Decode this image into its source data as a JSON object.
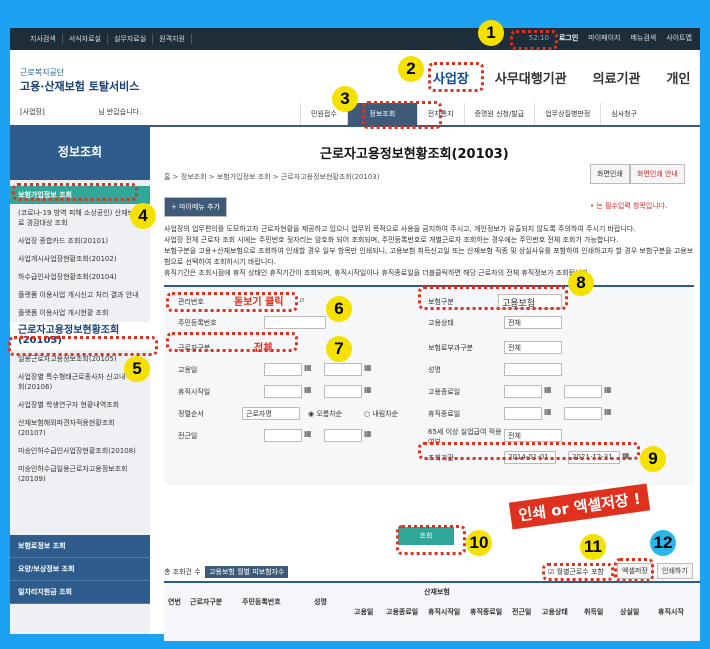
{
  "topbar": {
    "left": [
      "지사검색",
      "서식자료실",
      "실무자료실",
      "원격지원"
    ],
    "timer": "52:10",
    "login": "로그인",
    "right": [
      "마이페이지",
      "메뉴검색",
      "사이트맵"
    ]
  },
  "logo": {
    "sub": "근로복지공단",
    "main": "고용·산재보험 토탈서비스"
  },
  "mainnav": [
    "사업장",
    "사무대행기관",
    "의료기관",
    "개인"
  ],
  "welcome": "[사업장]",
  "welcome_tail": "님 반갑습니다.",
  "submenu": [
    "민원접수",
    "정보조회",
    "전자통지",
    "증명원 신청/발급",
    "업무상질병판정",
    "심사청구"
  ],
  "sidebar": {
    "title": "정보조회",
    "items": [
      "보험가입정보 조회",
      "(코로나-19 방역 피해 소상공인) 산재보험료 경감대상 조회",
      "사업장 종합카드 조회(20101)",
      "사업개시사업장현황조회(20102)",
      "하수급인사업장현황조회(20104)",
      "플랫폼 이용사업 개시신고 처리 결과 안내",
      "플랫폼 이용사업 개시현황 조회",
      "근로자고용정보현황조회(20103)",
      "일용근로자고용정보조회(20105)",
      "사업장별 특수형태근로종사자 신고내역조회(20106)",
      "사업장별 학생연구자 현황내역조회",
      "산재보험해외파견자적용현황조회(20107)",
      "미승인하수급인사업장현황조회(20108)",
      "미승인하수급일용근로자고용정보조회(20109)"
    ],
    "bottom": [
      "보험료정보 조회",
      "요양/보상정보 조회",
      "일자리지원금 조회"
    ]
  },
  "page": {
    "title": "근로자고용정보현황조회(20103)",
    "crumb": "홈 > 정보조회 > 보험가입정보 조회 > 근로자고용정보현황조회(20103)",
    "btn_print": "화면인쇄",
    "btn_guide": "화면인쇄 안내",
    "add_menu": "+ 마이메뉴 추가",
    "required": "• 는 필수입력 항목입니다."
  },
  "notices": [
    "사업장의 업무편의를 도모하고자 근로자현황을 제공하고 있으니 업무외 목적으로 사용을 금지하여 주시고, 개인정보가 유출되지 않도록 주의하여 주시기 바랍니다.",
    "사업장 전체 근로자 조회 시에는 주민번호 뒷자리는 암호화 되어 조회되며, 주민등록번호로 개별근로자 조회하는 경우에는 주민번호 전체 조회가 가능합니다.",
    "보험구분을 고용+산재보험으로 조회하여 인쇄할 경우 일부 항목만 인쇄되니, 고용보험 취득신고일 또는 산재보험 직종 및 상실사유를 포함하여 인쇄하고자 할 경우 보험구분을 고용보험으로 선택하여 조회하시기 바랍니다.",
    "휴직기간은 조회시점에 휴직 상태인 휴직기간이 조회되며, 휴직시작일이나 휴직종료일을 더블클릭하면 해당 근로자의 전체 휴직정보가 조회됩니다."
  ],
  "form": {
    "mgmt": "관리번호",
    "mgmt_hint": "돋보기 클릭",
    "rrn": "주민등록번호",
    "worker_type": "근로자구분",
    "worker_hint": "전체",
    "hire_date": "고용일",
    "leave_start": "휴직시작일",
    "sort": "정렬순서",
    "sort_val": "근로자명",
    "asc": "오름차순",
    "desc": "내림차순",
    "transfer": "전근일",
    "ins_type": "보험구분",
    "ins_val": "고용보험",
    "emp_state": "고용상태",
    "emp_val": "전체",
    "levy": "보험료부과구분",
    "levy_val": "전체",
    "name": "성명",
    "emp_end": "고용종료일",
    "leave_end": "휴직종료일",
    "over65": "65세 이상 실업급여 적용여부",
    "over65_val": "전체",
    "period": "조회기간",
    "from": "2014-01-01",
    "to": "2021-12-31"
  },
  "search_btn": "조회",
  "promo": "인쇄 or 엑셀저장 !",
  "table": {
    "total": "총 조회건 수",
    "tab": "고용보험 월별 피보험자수",
    "monthly": "월별근로수 포함",
    "excel": "엑셀저장",
    "print": "인쇄하기",
    "group": "산재보험",
    "headers": [
      "연번",
      "근로자구분",
      "주민등록번호",
      "성명",
      "고용일",
      "고용종료일",
      "휴직시작일",
      "휴직종료일",
      "전근일",
      "고용상태",
      "취득일",
      "상실일",
      "휴직시작"
    ]
  },
  "badges": [
    "1",
    "2",
    "3",
    "4",
    "5",
    "6",
    "7",
    "8",
    "9",
    "10",
    "11",
    "12"
  ]
}
